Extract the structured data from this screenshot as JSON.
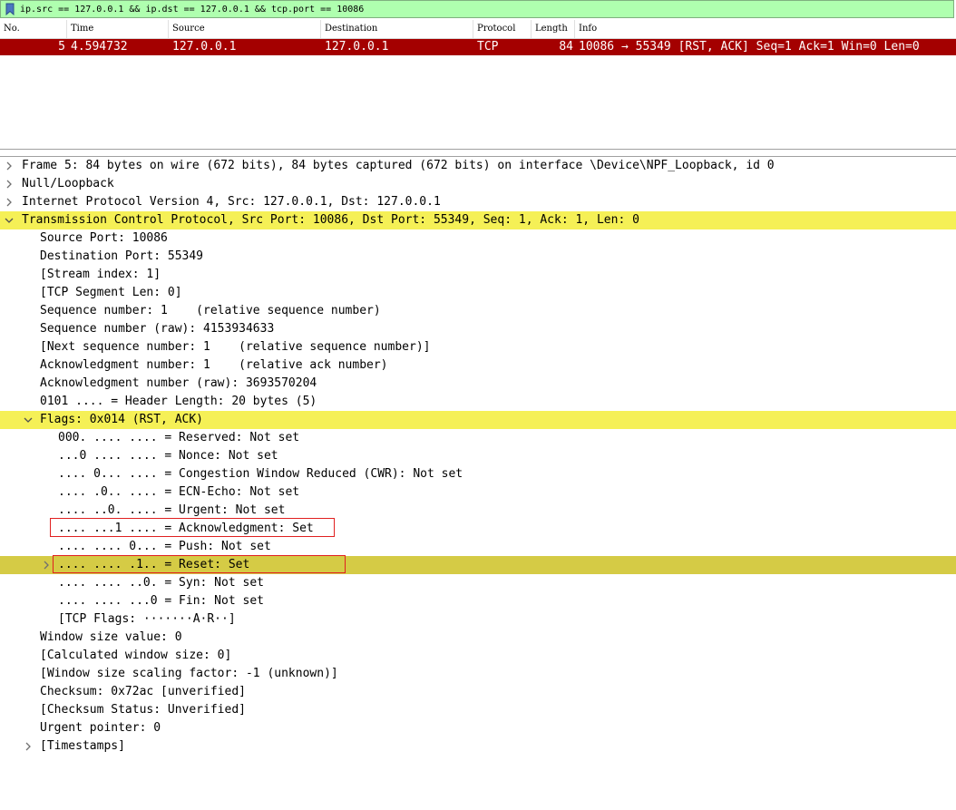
{
  "filter": {
    "value": "ip.src == 127.0.0.1 && ip.dst == 127.0.0.1 && tcp.port == 10086"
  },
  "packet_list": {
    "columns": [
      "No.",
      "Time",
      "Source",
      "Destination",
      "Protocol",
      "Length",
      "Info"
    ],
    "row": {
      "no": "5",
      "time": "4.594732",
      "source": "127.0.0.1",
      "destination": "127.0.0.1",
      "protocol": "TCP",
      "length": "84",
      "info": "10086 → 55349 [RST, ACK] Seq=1 Ack=1 Win=0 Len=0"
    }
  },
  "details": {
    "frame": "Frame 5: 84 bytes on wire (672 bits), 84 bytes captured (672 bits) on interface \\Device\\NPF_Loopback, id 0",
    "null_loopback": "Null/Loopback",
    "ipv4": "Internet Protocol Version 4, Src: 127.0.0.1, Dst: 127.0.0.1",
    "tcp": "Transmission Control Protocol, Src Port: 10086, Dst Port: 55349, Seq: 1, Ack: 1, Len: 0",
    "tcp_fields": [
      "Source Port: 10086",
      "Destination Port: 55349",
      "[Stream index: 1]",
      "[TCP Segment Len: 0]",
      "Sequence number: 1    (relative sequence number)",
      "Sequence number (raw): 4153934633",
      "[Next sequence number: 1    (relative sequence number)]",
      "Acknowledgment number: 1    (relative ack number)",
      "Acknowledgment number (raw): 3693570204",
      "0101 .... = Header Length: 20 bytes (5)"
    ],
    "flags": "Flags: 0x014 (RST, ACK)",
    "flag_fields": [
      "000. .... .... = Reserved: Not set",
      "...0 .... .... = Nonce: Not set",
      ".... 0... .... = Congestion Window Reduced (CWR): Not set",
      ".... .0.. .... = ECN-Echo: Not set",
      ".... ..0. .... = Urgent: Not set",
      ".... ...1 .... = Acknowledgment: Set",
      ".... .... 0... = Push: Not set",
      ".... .... .1.. = Reset: Set",
      ".... .... ..0. = Syn: Not set",
      ".... .... ...0 = Fin: Not set",
      "[TCP Flags: ·······A·R··]"
    ],
    "after_flags": [
      "Window size value: 0",
      "[Calculated window size: 0]",
      "[Window size scaling factor: -1 (unknown)]",
      "Checksum: 0x72ac [unverified]",
      "[Checksum Status: Unverified]",
      "Urgent pointer: 0"
    ],
    "timestamps": "[Timestamps]"
  },
  "colors": {
    "filter_bg": "#afffaf",
    "selected_row_bg": "#a40000",
    "highlight_yellow": "#f5f056",
    "highlight_olive": "#d5cb45",
    "annotation_red": "#e02020"
  }
}
